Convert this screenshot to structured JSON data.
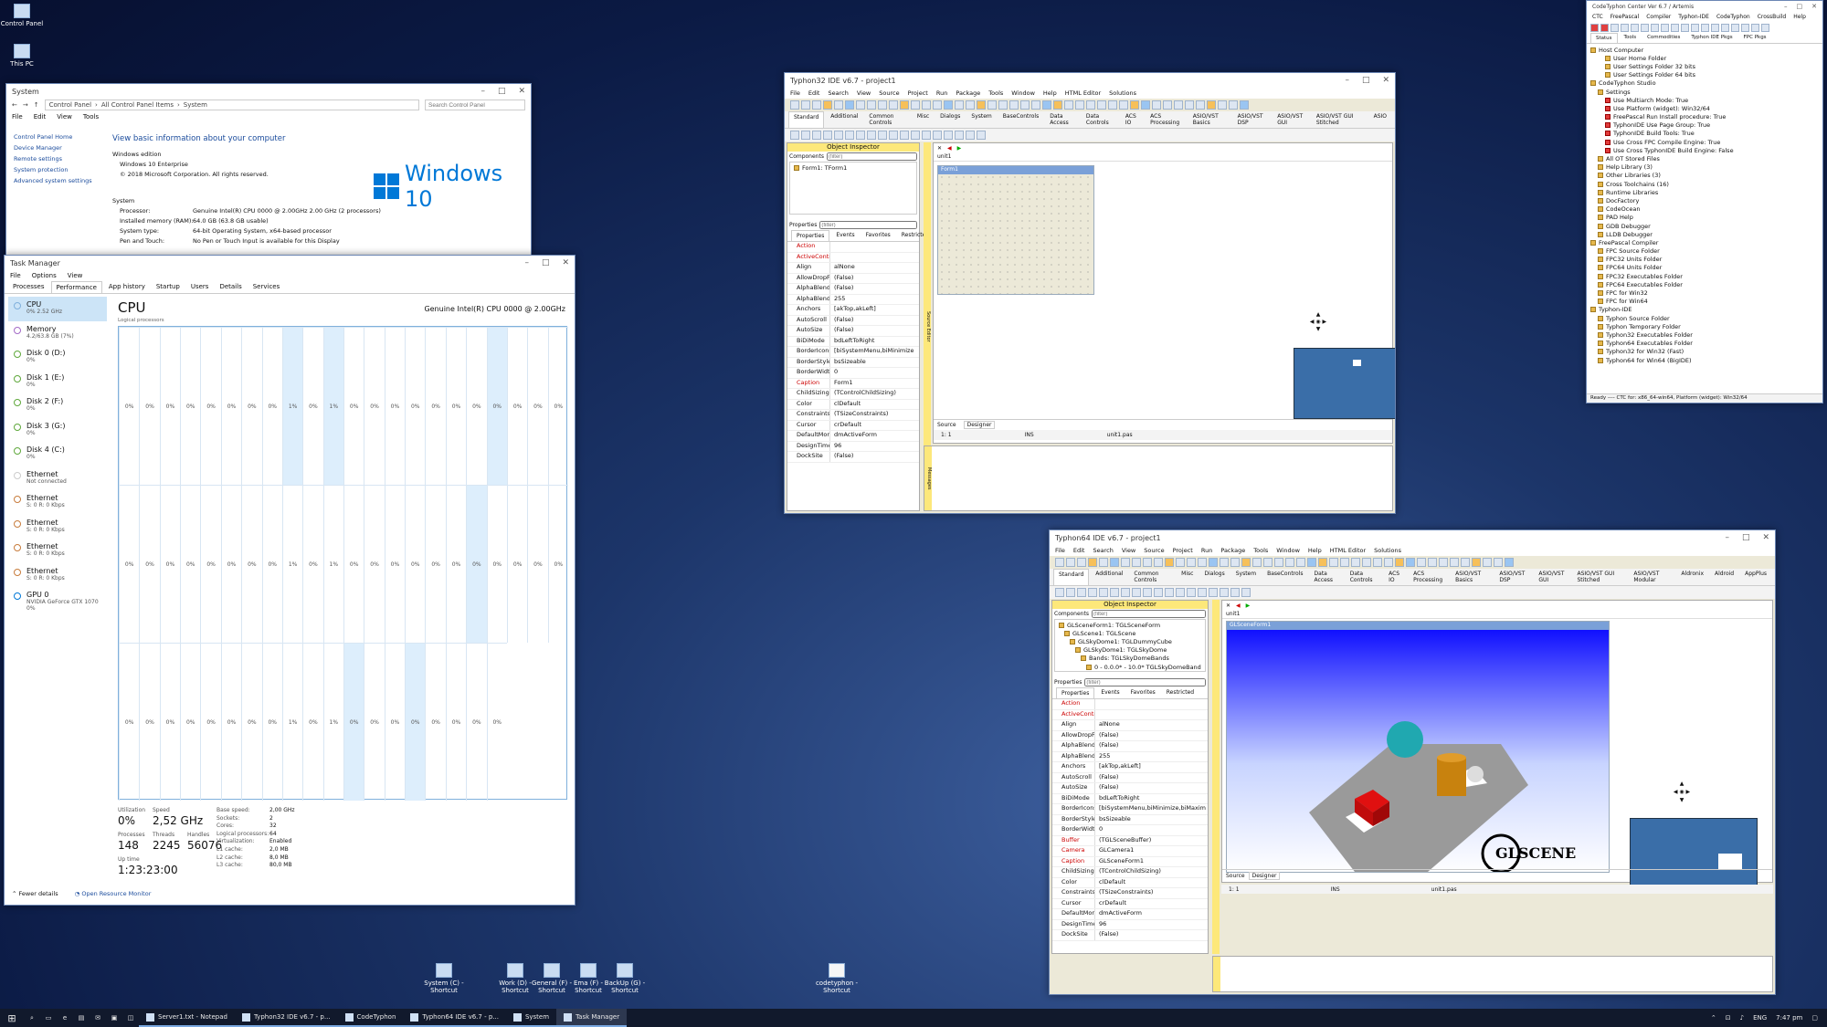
{
  "desktop": {
    "icons": [
      {
        "label": "Control Panel"
      },
      {
        "label": "This PC"
      },
      {
        "label": "System (C) - Shortcut"
      },
      {
        "label": "Work (D) - Shortcut"
      },
      {
        "label": "General (F) - Shortcut"
      },
      {
        "label": "Ema (F) - Shortcut"
      },
      {
        "label": "BackUp (G) - Shortcut"
      },
      {
        "label": "codetyphon - Shortcut"
      }
    ]
  },
  "system": {
    "title": "System",
    "breadcrumb": [
      "Control Panel",
      "All Control Panel Items",
      "System"
    ],
    "search_placeholder": "Search Control Panel",
    "menu": [
      "File",
      "Edit",
      "View",
      "Tools"
    ],
    "side_links": [
      "Control Panel Home",
      "Device Manager",
      "Remote settings",
      "System protection",
      "Advanced system settings"
    ],
    "heading": "View basic information about your computer",
    "edition_label": "Windows edition",
    "edition": "Windows 10 Enterprise",
    "copyright": "© 2018 Microsoft Corporation. All rights reserved.",
    "logo_text": "Windows 10",
    "section": "System",
    "rows": [
      {
        "k": "Processor:",
        "v": "Genuine Intel(R) CPU 0000 @ 2.00GHz   2.00 GHz  (2 processors)"
      },
      {
        "k": "Installed memory (RAM):",
        "v": "64.0 GB (63.8 GB usable)"
      },
      {
        "k": "System type:",
        "v": "64-bit Operating System, x64-based processor"
      },
      {
        "k": "Pen and Touch:",
        "v": "No Pen or Touch Input is available for this Display"
      }
    ]
  },
  "taskman": {
    "title": "Task Manager",
    "menu": [
      "File",
      "Options",
      "View"
    ],
    "tabs": [
      "Processes",
      "Performance",
      "App history",
      "Startup",
      "Users",
      "Details",
      "Services"
    ],
    "side": [
      {
        "n": "CPU",
        "s": "0% 2.52 GHz"
      },
      {
        "n": "Memory",
        "s": "4.2/63.8 GB (7%)"
      },
      {
        "n": "Disk 0 (D:)",
        "s": "0%"
      },
      {
        "n": "Disk 1 (E:)",
        "s": "0%"
      },
      {
        "n": "Disk 2 (F:)",
        "s": "0%"
      },
      {
        "n": "Disk 3 (G:)",
        "s": "0%"
      },
      {
        "n": "Disk 4 (C:)",
        "s": "0%"
      },
      {
        "n": "Ethernet",
        "s": "Not connected"
      },
      {
        "n": "Ethernet",
        "s": "S: 0 R: 0 Kbps"
      },
      {
        "n": "Ethernet",
        "s": "S: 0 R: 0 Kbps"
      },
      {
        "n": "Ethernet",
        "s": "S: 0 R: 0 Kbps"
      },
      {
        "n": "Ethernet",
        "s": "S: 0 R: 0 Kbps"
      },
      {
        "n": "GPU 0",
        "s": "NVIDIA GeForce GTX 1070 0%"
      }
    ],
    "cpu_title": "CPU",
    "cpu_model": "Genuine Intel(R) CPU 0000 @ 2.00GHz",
    "graph_caption": "Logical processors",
    "core_pct": [
      "0%",
      "0%",
      "0%",
      "0%",
      "0%",
      "0%",
      "0%",
      "0%",
      "1%",
      "0%",
      "1%",
      "0%",
      "0%",
      "0%",
      "0%",
      "0%",
      "0%",
      "0%",
      "0%",
      "0%",
      "0%",
      "0%"
    ],
    "stats": {
      "util_l": "Utilization",
      "util": "0%",
      "speed_l": "Speed",
      "speed": "2,52 GHz",
      "proc_l": "Processes",
      "proc": "148",
      "thr_l": "Threads",
      "thr": "2245",
      "hnd_l": "Handles",
      "hnd": "56076",
      "up_l": "Up time",
      "up": "1:23:23:00"
    },
    "details": [
      {
        "k": "Base speed:",
        "v": "2,00 GHz"
      },
      {
        "k": "Sockets:",
        "v": "2"
      },
      {
        "k": "Cores:",
        "v": "32"
      },
      {
        "k": "Logical processors:",
        "v": "64"
      },
      {
        "k": "Virtualization:",
        "v": "Enabled"
      },
      {
        "k": "L1 cache:",
        "v": "2,0 MB"
      },
      {
        "k": "L2 cache:",
        "v": "8,0 MB"
      },
      {
        "k": "L3 cache:",
        "v": "80,0 MB"
      }
    ],
    "footer": [
      "Fewer details",
      "Open Resource Monitor"
    ]
  },
  "ide1": {
    "title": "Typhon32 IDE v6.7 - project1",
    "menu": [
      "File",
      "Edit",
      "Search",
      "View",
      "Source",
      "Project",
      "Run",
      "Package",
      "Tools",
      "Window",
      "Help",
      "HTML Editor",
      "Solutions"
    ],
    "tabs": [
      "Standard",
      "Additional",
      "Common Controls",
      "Misc",
      "Dialogs",
      "System",
      "BaseControls",
      "Data Access",
      "Data Controls",
      "ACS IO",
      "ACS Processing",
      "ASIO/VST Basics",
      "ASIO/VST DSP",
      "ASIO/VST GUI",
      "ASIO/VST GUI Stitched",
      "ASIO"
    ],
    "oi_title": "Object Inspector",
    "components": "Components",
    "filter": "(filter)",
    "tree": [
      "Form1: TForm1"
    ],
    "properties": "Properties",
    "ptabs": [
      "Properties",
      "Events",
      "Favorites",
      "Restricted"
    ],
    "props": [
      [
        "Action",
        ""
      ],
      [
        "ActiveControl",
        ""
      ],
      [
        "Align",
        "alNone"
      ],
      [
        "AllowDropFiles",
        "(False)"
      ],
      [
        "AlphaBlend",
        "(False)"
      ],
      [
        "AlphaBlendValue",
        "255"
      ],
      [
        "Anchors",
        "[akTop,akLeft]"
      ],
      [
        "AutoScroll",
        "(False)"
      ],
      [
        "AutoSize",
        "(False)"
      ],
      [
        "BiDiMode",
        "bdLeftToRight"
      ],
      [
        "BorderIcons",
        "[biSystemMenu,biMinimize"
      ],
      [
        "BorderStyle",
        "bsSizeable"
      ],
      [
        "BorderWidth",
        "0"
      ],
      [
        "Caption",
        "Form1"
      ],
      [
        "ChildSizing",
        "(TControlChildSizing)"
      ],
      [
        "Color",
        "clDefault"
      ],
      [
        "Constraints",
        "(TSizeConstraints)"
      ],
      [
        "Cursor",
        "crDefault"
      ],
      [
        "DefaultMonitor",
        "dmActiveForm"
      ],
      [
        "DesignTimePPI",
        "96"
      ],
      [
        "DockSite",
        "(False)"
      ]
    ],
    "editor_tab": "unit1",
    "form_caption": "Form1",
    "bottom_tabs": [
      "Source",
      "Designer"
    ],
    "status": [
      "1: 1",
      "INS",
      "unit1.pas"
    ],
    "side_labels": [
      "Source Editor",
      "Messages"
    ]
  },
  "ide2": {
    "title": "Typhon64 IDE v6.7 - project1",
    "menu": [
      "File",
      "Edit",
      "Search",
      "View",
      "Source",
      "Project",
      "Run",
      "Package",
      "Tools",
      "Window",
      "Help",
      "HTML Editor",
      "Solutions"
    ],
    "tabs": [
      "Standard",
      "Additional",
      "Common Controls",
      "Misc",
      "Dialogs",
      "System",
      "BaseControls",
      "Data Access",
      "Data Controls",
      "ACS IO",
      "ACS Processing",
      "ASIO/VST Basics",
      "ASIO/VST DSP",
      "ASIO/VST GUI",
      "ASIO/VST GUI Stitched",
      "ASIO/VST Modular",
      "Aldronix",
      "Aldroid",
      "AppPlus"
    ],
    "oi_title": "Object Inspector",
    "components": "Components",
    "filter": "(filter)",
    "tree": [
      "GLSceneForm1: TGLSceneForm",
      "GLScene1: TGLScene",
      "GLSkyDome1: TGLDummyCube",
      "GLSkyDome1: TGLSkyDome",
      "Bands: TGLSkyDomeBands",
      "0 - 0.0.0* - 10.0* TGLSkyDomeBand"
    ],
    "properties": "Properties",
    "ptabs": [
      "Properties",
      "Events",
      "Favorites",
      "Restricted"
    ],
    "props": [
      [
        "Action",
        ""
      ],
      [
        "ActiveControl",
        ""
      ],
      [
        "Align",
        "alNone"
      ],
      [
        "AllowDropFiles",
        "(False)"
      ],
      [
        "AlphaBlend",
        "(False)"
      ],
      [
        "AlphaBlendValue",
        "255"
      ],
      [
        "Anchors",
        "[akTop,akLeft]"
      ],
      [
        "AutoScroll",
        "(False)"
      ],
      [
        "AutoSize",
        "(False)"
      ],
      [
        "BiDiMode",
        "bdLeftToRight"
      ],
      [
        "BorderIcons",
        "[biSystemMenu,biMinimize,biMaxim"
      ],
      [
        "BorderStyle",
        "bsSizeable"
      ],
      [
        "BorderWidth",
        "0"
      ],
      [
        "Buffer",
        "(TGLSceneBuffer)"
      ],
      [
        "Camera",
        "GLCamera1"
      ],
      [
        "Caption",
        "GLSceneForm1"
      ],
      [
        "ChildSizing",
        "(TControlChildSizing)"
      ],
      [
        "Color",
        "clDefault"
      ],
      [
        "Constraints",
        "(TSizeConstraints)"
      ],
      [
        "Cursor",
        "crDefault"
      ],
      [
        "DefaultMonitor",
        "dmActiveForm"
      ],
      [
        "DesignTimePPI",
        "96"
      ],
      [
        "DockSite",
        "(False)"
      ]
    ],
    "editor_tab": "unit1",
    "form_caption": "GLSceneForm1",
    "logo": "GLSCENE",
    "bottom_tabs": [
      "Source",
      "Designer"
    ],
    "status": [
      "1: 1",
      "INS",
      "unit1.pas"
    ]
  },
  "ctc": {
    "title": "CodeTyphon Center Ver 6.7 / Artemis",
    "menu": [
      "CTC",
      "FreePascal",
      "Compiler",
      "Typhon-IDE",
      "CodeTyphon",
      "CrossBuild",
      "Help"
    ],
    "tabs": [
      "Status",
      "Tools",
      "Commodities",
      "Typhon IDE Pkgs",
      "FPC Pkgs"
    ],
    "tree": [
      "Host Computer",
      "User Home Folder",
      "User Settings Folder 32 bits",
      "User Settings Folder 64 bits",
      "CodeTyphon Studio",
      "Settings",
      "Use Multiarch Mode: True",
      "Use Platform (widget): Win32/64",
      "FreePascal Run Install procedure: True",
      "TyphonIDE Use Page Group: True",
      "TyphonIDE Build Tools: True",
      "Use Cross FPC Compile Engine: True",
      "Use Cross TyphonIDE Build Engine: False",
      "All OT Stored Files",
      "Help Library (3)",
      "Other Libraries (3)",
      "Cross Toolchains (16)",
      "Runtime Libraries",
      "DocFactory",
      "CodeOcean",
      "PAD Help",
      "GDB Debugger",
      "LLDB Debugger",
      "FreePascal Compiler",
      "FPC Source Folder",
      "FPC32 Units Folder",
      "FPC64 Units Folder",
      "FPC32 Executables Folder",
      "FPC64 Executables Folder",
      "FPC for Win32",
      "FPC for Win64",
      "Typhon-IDE",
      "Typhon Source Folder",
      "Typhon Temporary Folder",
      "Typhon32 Executables Folder",
      "Typhon64 Executables Folder",
      "Typhon32 for Win32 (Fast)",
      "Typhon64 for Win64 (BigIDE)"
    ],
    "status": "Ready ---- CTC for: x86_64-win64, Platform (widget): Win32/64"
  },
  "taskbar": {
    "apps": [
      "Server1.txt - Notepad",
      "Typhon32 IDE v6.7 - p...",
      "CodeTyphon",
      "Typhon64 IDE v6.7 - p...",
      "System",
      "Task Manager"
    ],
    "lang": "ENG",
    "time": "7:47 pm"
  },
  "colors": {
    "accent": "#0078d7",
    "cpu_fill": "#ddeefc",
    "cpu_line": "#7fb0dc",
    "ide_bg": "#ece9d8",
    "ide_form": "#3a6ea8"
  }
}
